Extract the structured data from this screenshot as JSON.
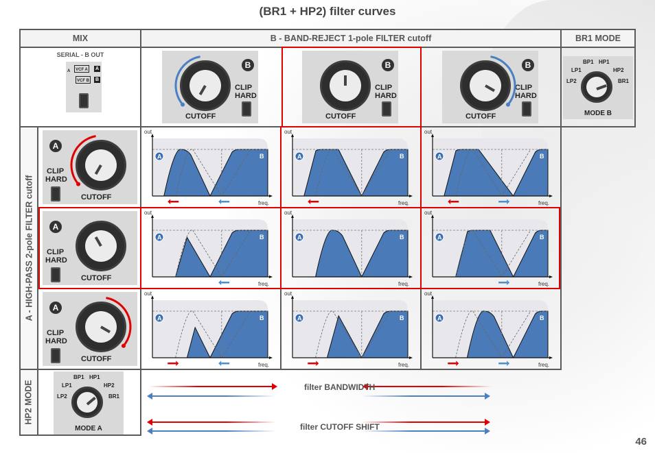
{
  "title": "(BR1 + HP2) filter curves",
  "page_number": "46",
  "headers": {
    "mix": "MIX",
    "band_reject": "B - BAND-REJECT 1-pole FILTER cutoff",
    "br1_mode": "BR1 MODE"
  },
  "row_labels": {
    "high_pass": "A - HIGH-PASS 2-pole FILTER cutoff",
    "hp2_mode": "HP2 MODE"
  },
  "mix_panel": {
    "label": "SERIAL - B OUT",
    "input": "A",
    "vcf_a": "VCF A",
    "vcf_b": "VCF B",
    "out_a": "A",
    "out_b": "B"
  },
  "knob_panel": {
    "cutoff": "CUTOFF",
    "clip": "CLIP",
    "hard": "HARD",
    "badge_a": "A",
    "badge_b": "B"
  },
  "mode_b": {
    "label": "MODE B",
    "positions": [
      "LP2",
      "LP1",
      "BP1",
      "HP1",
      "HP2",
      "BR1"
    ],
    "selected": "BR1"
  },
  "mode_a": {
    "label": "MODE A",
    "positions": [
      "LP2",
      "LP1",
      "BP1",
      "HP1",
      "HP2",
      "BR1"
    ],
    "selected": "HP2"
  },
  "b_cutoff_columns": [
    {
      "setting": "low",
      "arrow": "counter-clockwise",
      "arrow_color": "#4a7fc1"
    },
    {
      "setting": "center",
      "arrow": "none",
      "selected": true
    },
    {
      "setting": "high",
      "arrow": "clockwise",
      "arrow_color": "#4a7fc1"
    }
  ],
  "a_cutoff_rows": [
    {
      "setting": "low",
      "arrow": "counter-clockwise",
      "arrow_color": "#e00000"
    },
    {
      "setting": "center",
      "arrow": "none",
      "selected": true
    },
    {
      "setting": "high",
      "arrow": "clockwise",
      "arrow_color": "#e00000"
    }
  ],
  "chart_data": {
    "type": "area",
    "title": "(BR1 + HP2) filter curves",
    "xlabel": "freq.",
    "ylabel": "out",
    "legend": {
      "A": "high-pass 2-pole",
      "B": "band-reject 1-pole"
    },
    "colors": {
      "fill": "#4a7ab8",
      "panel": "#e8e8ec",
      "red_arrow": "#e00000",
      "blue_arrow": "#4a8fd0"
    },
    "grid": [
      [
        {
          "hp_start": 0.1,
          "hp_peak": 0.25,
          "notch": 0.5,
          "b_flat": 0.75,
          "flat_top": false,
          "hp_arrow": "left",
          "br_arrow": "left",
          "ghost": true
        },
        {
          "hp_start": 0.1,
          "hp_peak": 0.25,
          "notch": 0.6,
          "b_flat": 0.85,
          "flat_top": true,
          "hp_arrow": "left",
          "br_arrow": "none",
          "ghost": true
        },
        {
          "hp_start": 0.1,
          "hp_peak": 0.25,
          "notch": 0.7,
          "b_flat": 0.95,
          "flat_top": true,
          "hp_arrow": "left",
          "br_arrow": "right",
          "ghost": true
        }
      ],
      [
        {
          "hp_start": 0.2,
          "hp_peak": 0.3,
          "notch": 0.5,
          "b_flat": 0.75,
          "flat_top": false,
          "hp_arrow": "none",
          "br_arrow": "left",
          "ghost": true
        },
        {
          "hp_start": 0.2,
          "hp_peak": 0.35,
          "notch": 0.6,
          "b_flat": 0.85,
          "flat_top": false,
          "hp_arrow": "none",
          "br_arrow": "none",
          "ghost": false
        },
        {
          "hp_start": 0.2,
          "hp_peak": 0.35,
          "notch": 0.7,
          "b_flat": 0.95,
          "flat_top": true,
          "hp_arrow": "none",
          "br_arrow": "right",
          "ghost": true
        }
      ],
      [
        {
          "hp_start": 0.3,
          "hp_peak": 0.37,
          "notch": 0.5,
          "b_flat": 0.75,
          "flat_top": false,
          "hp_arrow": "right",
          "br_arrow": "left",
          "ghost": true
        },
        {
          "hp_start": 0.3,
          "hp_peak": 0.4,
          "notch": 0.6,
          "b_flat": 0.85,
          "flat_top": false,
          "hp_arrow": "right",
          "br_arrow": "none",
          "ghost": true
        },
        {
          "hp_start": 0.3,
          "hp_peak": 0.45,
          "notch": 0.7,
          "b_flat": 0.95,
          "flat_top": false,
          "hp_arrow": "right",
          "br_arrow": "right",
          "ghost": true
        }
      ]
    ],
    "peak_heights": [
      [
        1.0,
        1.0,
        1.0
      ],
      [
        0.85,
        1.0,
        1.0
      ],
      [
        0.65,
        0.9,
        1.0
      ]
    ]
  },
  "legend_arrows": {
    "bandwidth": "filter BANDWIDTH",
    "cutoff_shift": "filter CUTOFF SHIFT"
  }
}
